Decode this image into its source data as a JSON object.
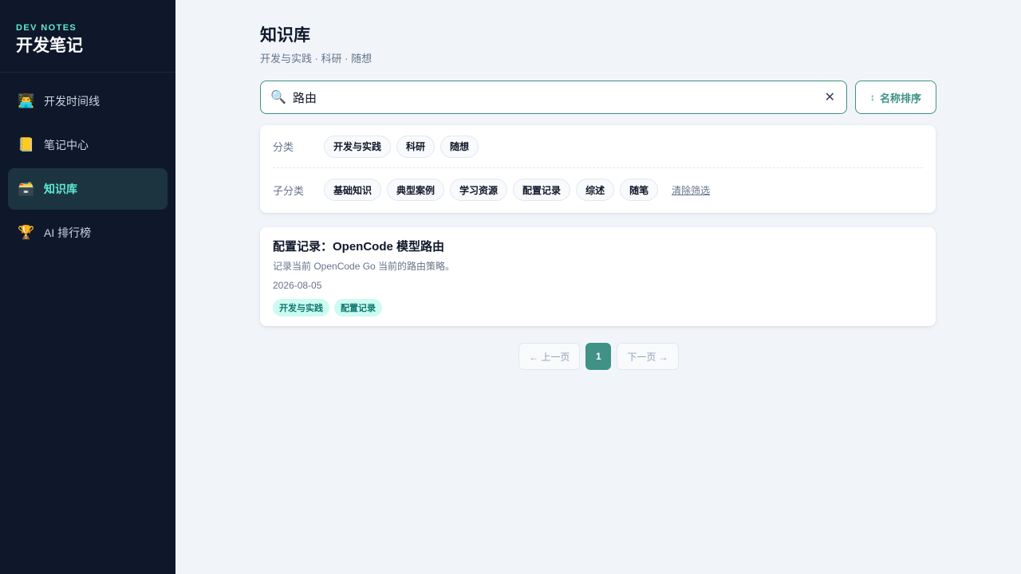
{
  "sidebar": {
    "brand_tag": "DEV NOTES",
    "brand_title": "开发笔记",
    "items": [
      {
        "icon": "👨‍💻",
        "label": "开发时间线",
        "active": false
      },
      {
        "icon": "📒",
        "label": "笔记中心",
        "active": false
      },
      {
        "icon": "🗃️",
        "label": "知识库",
        "active": true
      },
      {
        "icon": "🏆",
        "label": "AI 排行榜",
        "active": false
      }
    ]
  },
  "header": {
    "title": "知识库",
    "subtitle": "开发与实践 · 科研 · 随想"
  },
  "search": {
    "icon": "🔍",
    "value": "路由",
    "clear": "✕"
  },
  "sort": {
    "icon": "↕",
    "label": "名称排序"
  },
  "filters": {
    "category_label": "分类",
    "categories": [
      "开发与实践",
      "科研",
      "随想"
    ],
    "subcategory_label": "子分类",
    "subcategories": [
      "基础知识",
      "典型案例",
      "学习资源",
      "配置记录",
      "综述",
      "随笔"
    ],
    "clear_label": "清除筛选"
  },
  "results": [
    {
      "title": "配置记录：OpenCode 模型路由",
      "description": "记录当前 OpenCode Go 当前的路由策略。",
      "date": "2026-08-05",
      "tags": [
        "开发与实践",
        "配置记录"
      ]
    }
  ],
  "pagination": {
    "prev": "← 上一页",
    "current": "1",
    "next": "下一页 →"
  },
  "colors": {
    "accent": "#3f9285",
    "sidebar_bg": "#0f172a",
    "active_text": "#5eead4",
    "tag_bg": "#ccfbf1"
  }
}
